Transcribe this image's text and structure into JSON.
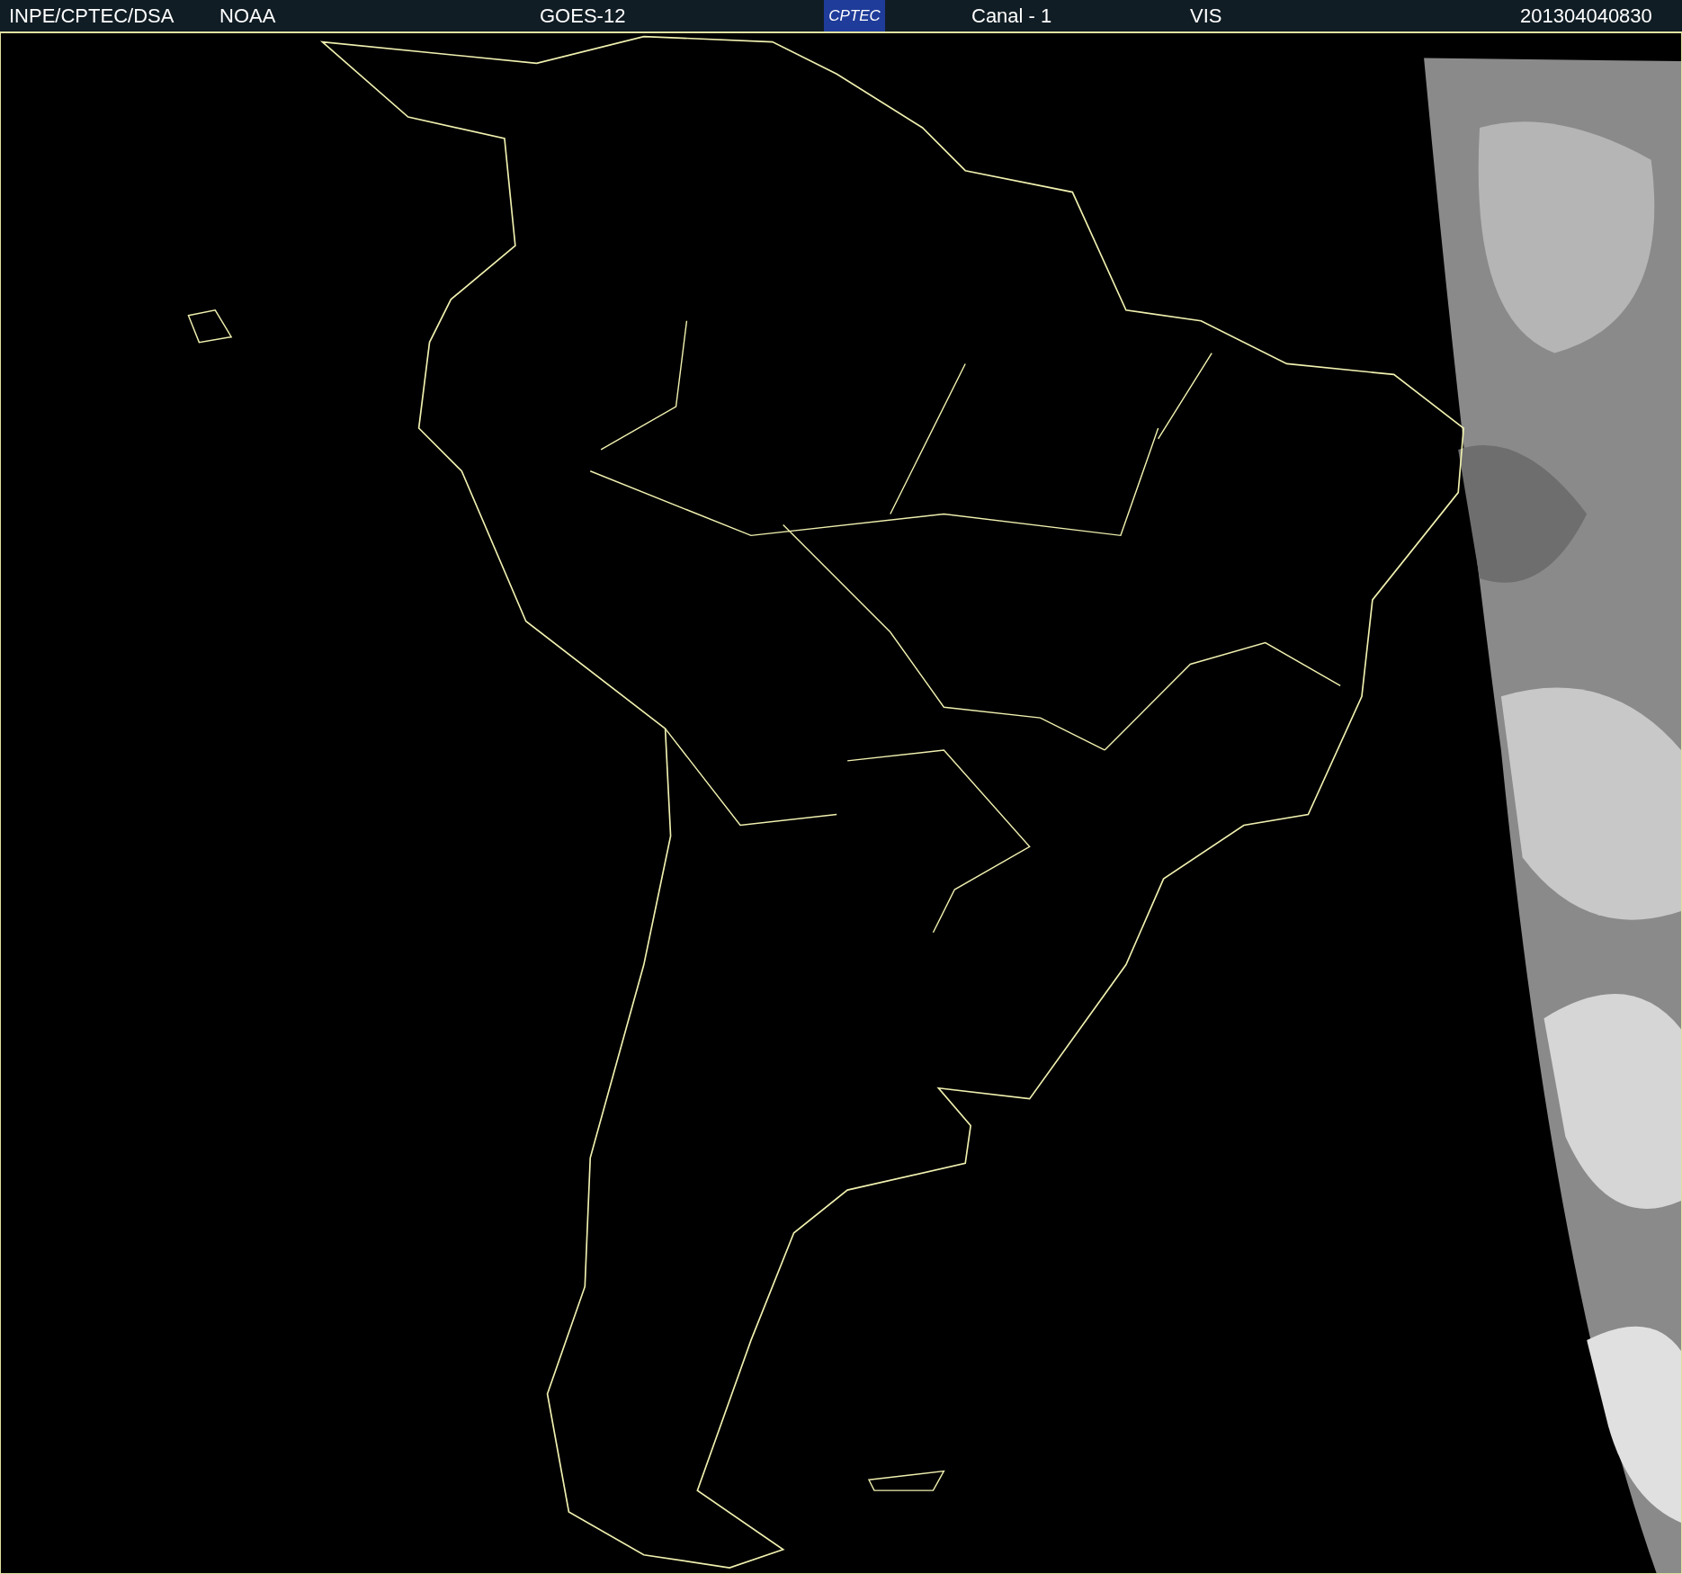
{
  "header": {
    "left": [
      "INPE/CPTEC/DSA",
      "NOAA"
    ],
    "satellite": "GOES-12",
    "logo": "CPTEC",
    "channel": "Canal - 1",
    "band": "VIS",
    "timestamp": "201304040830"
  }
}
